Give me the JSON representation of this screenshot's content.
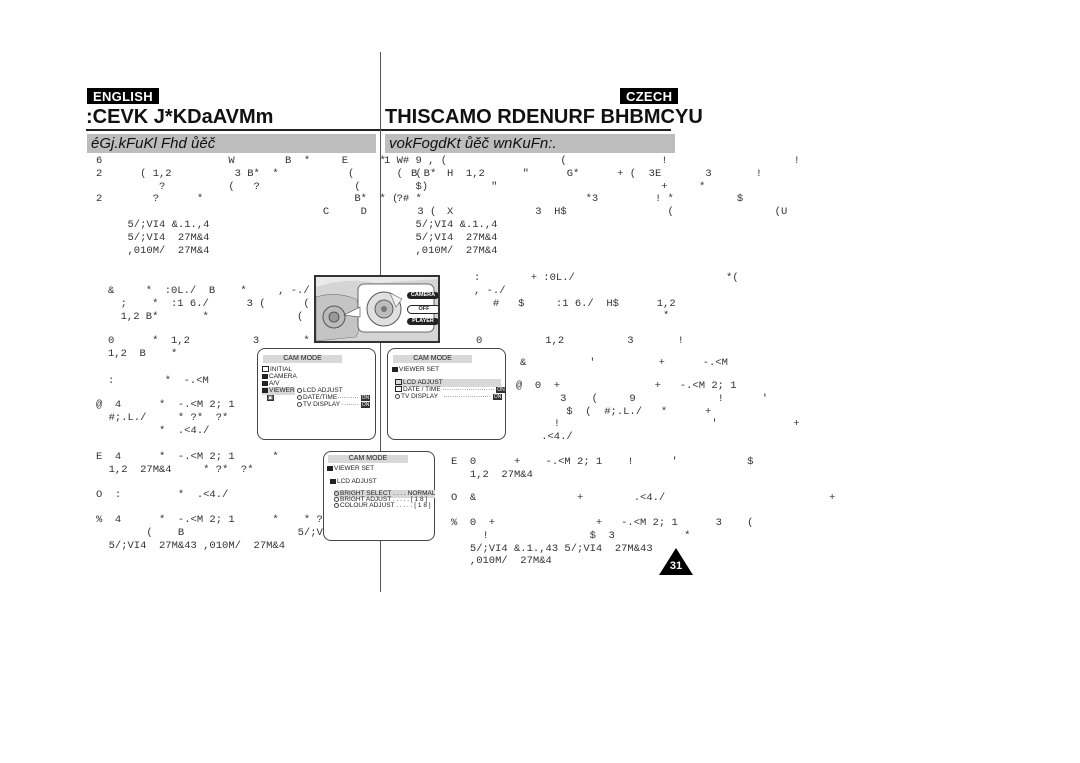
{
  "header": {
    "left_language": "ENGLISH",
    "right_language": "CZECH",
    "left_title": ":CEVK J*KDaAVMm",
    "right_title": "THISCAMO RDENURF BHBMCYU"
  },
  "sections": {
    "left_heading": "éGj.kFuKl Fhd ůěč",
    "right_heading": "vokFogdKt ůěč wnKuFn:."
  },
  "left_column": {
    "intro_lines": [
      "6                    W        B  *     E     *",
      "2      ( 1,2          3 B*  *           (         B B*",
      "          ?          (   ?               (",
      "2        ?      *                        B*  * (",
      "                                    C     D        3 (",
      "     5/;VI4 &.1.,4",
      "     5/;VI4  27M&4",
      "     ,010M/  27M&4"
    ],
    "step_block_1": [
      "&     *  :0L./  B    *     , -./",
      "  ;    *  :1 6./      3 (      (     (",
      "  1,2 B*       *              (  ?"
    ],
    "step_block_2": [
      "0      *  1,2          3       *",
      "1,2  B    *"
    ],
    "step_1": ":        *  -.<M",
    "step_2": [
      "@  4      *  -.<M 2; 1      *",
      "  #;.L./     * ?*  ?*",
      "          *  .<4./"
    ],
    "step_3": [
      "E  4      *  -.<M 2; 1      *",
      "  1,2  27M&4     * ?*  ?*"
    ],
    "step_4": "O  :         *  .<4./                *",
    "step_5": [
      "%  4      *  -.<M 2; 1      *    * ?*  ?*",
      "        (    B                  5/;VI4 &.1.,43",
      "  5/;VI4  27M&43 ,010M/  27M&4"
    ]
  },
  "right_column": {
    "intro_lines": [
      "1 W# 9 , (                  (               !                    !",
      "  (  (    H  1,2      \"      G*      + (  3E       3       !",
      "     $)          \"                          +     *",
      "  ?# *                          *3         ! *          $",
      "          X             3  H$                (                (U",
      "     5/;VI4 &.1.,4",
      "     5/;VI4  27M&4",
      "     ,010M/  27M&4"
    ],
    "step_block_1": [
      ":        + :0L./                        *(",
      ", -./",
      "   #   $     :1 6./  H$      1,2",
      "                              *"
    ],
    "step_block_2": "0          1,2          3       !",
    "step_1": "&          '          +      -.<M",
    "step_2": [
      "@  0  +               +   -.<M 2; 1",
      "       3    (     9             !      '",
      "        $  (  #;.L./   *      +",
      "      !                        '            +",
      "    .<4./"
    ],
    "step_3": [
      "E  0      +    -.<M 2; 1    !      '           $",
      "   1,2  27M&4"
    ],
    "step_4": "O  &                +        .<4./                          +",
    "step_5": [
      "%  0  +                +   -.<M 2; 1      3    (",
      "     !                $  3           *",
      "   5/;VI4 &.1.,43 5/;VI4  27M&43",
      "   ,010M/  27M&4"
    ]
  },
  "camera_dial": {
    "positions": [
      "CAMERA",
      "OFF",
      "PLAYER"
    ]
  },
  "menu_screen_1": {
    "header": "CAM MODE",
    "items": [
      "INITIAL",
      "CAMERA",
      "A/V",
      "VIEWER"
    ],
    "sub_items": [
      "LCD ADJUST",
      "DATE/TIME",
      "TV DISPLAY"
    ],
    "sub_values": [
      "ON",
      "ON"
    ]
  },
  "menu_screen_2": {
    "header": "CAM MODE",
    "parent": "VIEWER SET",
    "items": [
      "LCD ADJUST",
      "DATE / TIME",
      "TV DISPLAY"
    ],
    "values": [
      "ON",
      "ON"
    ]
  },
  "menu_screen_3": {
    "header": "CAM MODE",
    "parent": "VIEWER SET",
    "sub_parent": "LCD ADJUST",
    "items": [
      "BRIGHT SELECT . . . . NORMAL",
      "BRIGHT ADJUST . . . . . [ 1 8 ]",
      "COLOUR ADJUST . . . . . [ 1 8 ]"
    ]
  },
  "footer": {
    "page_number": "31"
  }
}
